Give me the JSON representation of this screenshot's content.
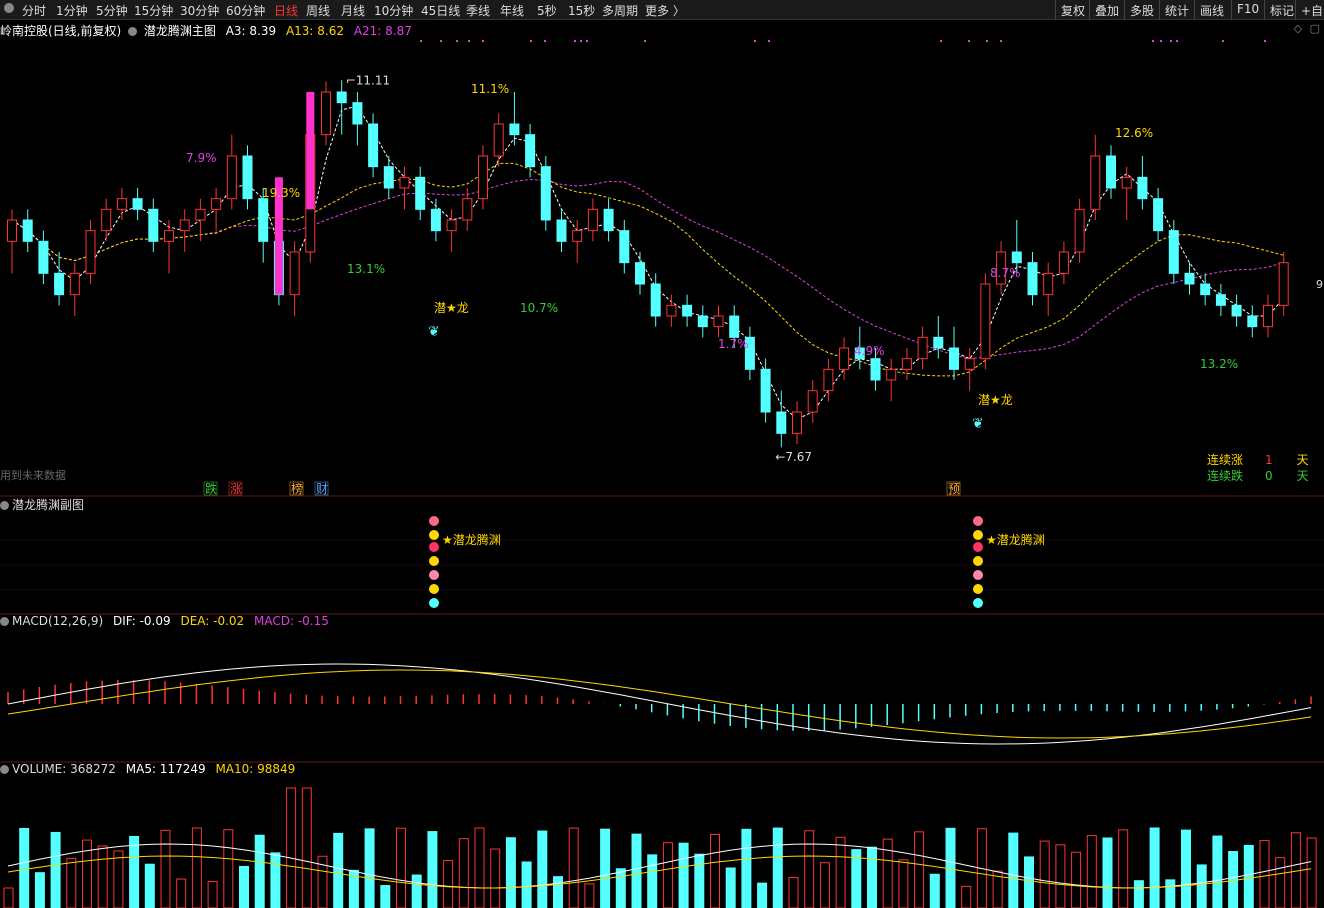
{
  "toolbar": {
    "periods": [
      "分时",
      "1分钟",
      "5分钟",
      "15分钟",
      "30分钟",
      "60分钟",
      "日线",
      "周线",
      "月线",
      "10分钟",
      "45日线",
      "季线",
      "年线",
      "5秒",
      "15秒",
      "多周期",
      "更多 〉"
    ],
    "active_period": "日线",
    "right_tools": [
      "复权",
      "叠加",
      "多股",
      "统计",
      "画线",
      "F10",
      "标记",
      "+自"
    ]
  },
  "main_chart": {
    "stock_title": "岭南控股(日线,前复权)",
    "indicator_name": "潜龙腾渊主图",
    "a3": "A3: 8.39",
    "a13": "A13: 8.62",
    "a21": "A21: 8.87",
    "high_label": "11.11",
    "low_label": "7.67",
    "future_data_note": "用到未来数据",
    "right_edge_label": "9",
    "pct_labels": [
      {
        "text": "7.9%",
        "color": "#e040e0"
      },
      {
        "text": "19.3%",
        "color": "#ffd700"
      },
      {
        "text": "11.1%",
        "color": "#ffd700"
      },
      {
        "text": "13.1%",
        "color": "#33cc33"
      },
      {
        "text": "10.7%",
        "color": "#33cc33"
      },
      {
        "text": "1.7%",
        "color": "#e040e0"
      },
      {
        "text": "4.9%",
        "color": "#e040e0"
      },
      {
        "text": "8.7%",
        "color": "#e040e0"
      },
      {
        "text": "12.6%",
        "color": "#ffd700"
      },
      {
        "text": "13.2%",
        "color": "#33cc33"
      }
    ],
    "dragon_labels": [
      "潜★龙",
      "潜★龙"
    ],
    "bottom_markers": [
      {
        "text": "跌",
        "color": "#33cc33"
      },
      {
        "text": "涨",
        "color": "#ff3333"
      },
      {
        "text": "榜",
        "color": "#ffaa33"
      },
      {
        "text": "财",
        "color": "#55aaff"
      },
      {
        "text": "预",
        "color": "#ffaa33"
      }
    ],
    "streak": {
      "up_label": "连续涨",
      "up_count": "1",
      "up_unit": "天",
      "down_label": "连续跌",
      "down_count": "0",
      "down_unit": "天"
    },
    "colors": {
      "up": "#ff3333",
      "down": "#54ffff",
      "a3": "#ffffff",
      "a13": "#ffd700",
      "a21": "#e040e0"
    }
  },
  "sub_chart": {
    "title": "潜龙腾渊副图",
    "signal_labels": [
      "★潜龙腾渊",
      "★潜龙腾渊"
    ]
  },
  "macd": {
    "title": "MACD(12,26,9)",
    "dif": "DIF: -0.09",
    "dea": "DEA: -0.02",
    "macd": "MACD: -0.15"
  },
  "volume": {
    "title": "VOLUME: 368272",
    "ma5": "MA5: 117249",
    "ma10": "MA10: 98849"
  },
  "chart_data": {
    "type": "candlestick",
    "price_high": 11.11,
    "price_low": 7.67,
    "candles": [
      [
        9.6,
        9.9,
        9.3,
        9.8
      ],
      [
        9.8,
        9.9,
        9.5,
        9.6
      ],
      [
        9.6,
        9.7,
        9.2,
        9.3
      ],
      [
        9.3,
        9.5,
        9.0,
        9.1
      ],
      [
        9.1,
        9.4,
        8.9,
        9.3
      ],
      [
        9.3,
        9.8,
        9.2,
        9.7
      ],
      [
        9.7,
        10.0,
        9.6,
        9.9
      ],
      [
        9.9,
        10.1,
        9.8,
        10.0
      ],
      [
        10.0,
        10.1,
        9.8,
        9.9
      ],
      [
        9.9,
        10.0,
        9.5,
        9.6
      ],
      [
        9.6,
        9.8,
        9.3,
        9.7
      ],
      [
        9.7,
        9.9,
        9.5,
        9.8
      ],
      [
        9.8,
        10.0,
        9.6,
        9.9
      ],
      [
        9.9,
        10.1,
        9.7,
        10.0
      ],
      [
        10.0,
        10.6,
        9.9,
        10.4
      ],
      [
        10.4,
        10.5,
        9.9,
        10.0
      ],
      [
        10.0,
        10.1,
        9.4,
        9.6
      ],
      [
        9.6,
        10.2,
        9.0,
        9.1
      ],
      [
        9.1,
        9.6,
        8.9,
        9.5
      ],
      [
        9.5,
        10.7,
        9.4,
        10.6
      ],
      [
        10.6,
        11.1,
        10.5,
        11.0
      ],
      [
        11.0,
        11.11,
        10.6,
        10.9
      ],
      [
        10.9,
        11.0,
        10.5,
        10.7
      ],
      [
        10.7,
        10.8,
        10.2,
        10.3
      ],
      [
        10.3,
        10.4,
        10.0,
        10.1
      ],
      [
        10.1,
        10.3,
        9.9,
        10.2
      ],
      [
        10.2,
        10.3,
        9.8,
        9.9
      ],
      [
        9.9,
        10.0,
        9.6,
        9.7
      ],
      [
        9.7,
        9.9,
        9.5,
        9.8
      ],
      [
        9.8,
        10.1,
        9.7,
        10.0
      ],
      [
        10.0,
        10.5,
        9.9,
        10.4
      ],
      [
        10.4,
        10.8,
        10.3,
        10.7
      ],
      [
        10.7,
        11.0,
        10.5,
        10.6
      ],
      [
        10.6,
        10.7,
        10.2,
        10.3
      ],
      [
        10.3,
        10.4,
        9.7,
        9.8
      ],
      [
        9.8,
        9.9,
        9.5,
        9.6
      ],
      [
        9.6,
        9.8,
        9.4,
        9.7
      ],
      [
        9.7,
        10.0,
        9.6,
        9.9
      ],
      [
        9.9,
        10.0,
        9.6,
        9.7
      ],
      [
        9.7,
        9.8,
        9.3,
        9.4
      ],
      [
        9.4,
        9.5,
        9.1,
        9.2
      ],
      [
        9.2,
        9.3,
        8.8,
        8.9
      ],
      [
        8.9,
        9.1,
        8.8,
        9.0
      ],
      [
        9.0,
        9.1,
        8.8,
        8.9
      ],
      [
        8.9,
        9.0,
        8.7,
        8.8
      ],
      [
        8.8,
        9.0,
        8.7,
        8.9
      ],
      [
        8.9,
        9.0,
        8.6,
        8.7
      ],
      [
        8.7,
        8.8,
        8.3,
        8.4
      ],
      [
        8.4,
        8.5,
        7.9,
        8.0
      ],
      [
        8.0,
        8.2,
        7.67,
        7.8
      ],
      [
        7.8,
        8.1,
        7.7,
        8.0
      ],
      [
        8.0,
        8.3,
        7.9,
        8.2
      ],
      [
        8.2,
        8.5,
        8.1,
        8.4
      ],
      [
        8.4,
        8.7,
        8.3,
        8.6
      ],
      [
        8.6,
        8.8,
        8.4,
        8.5
      ],
      [
        8.5,
        8.6,
        8.2,
        8.3
      ],
      [
        8.3,
        8.5,
        8.1,
        8.4
      ],
      [
        8.4,
        8.6,
        8.3,
        8.5
      ],
      [
        8.5,
        8.8,
        8.4,
        8.7
      ],
      [
        8.7,
        8.9,
        8.5,
        8.6
      ],
      [
        8.6,
        8.8,
        8.3,
        8.4
      ],
      [
        8.4,
        8.6,
        8.2,
        8.5
      ],
      [
        8.5,
        9.3,
        8.4,
        9.2
      ],
      [
        9.2,
        9.6,
        9.1,
        9.5
      ],
      [
        9.5,
        9.8,
        9.3,
        9.4
      ],
      [
        9.4,
        9.5,
        9.0,
        9.1
      ],
      [
        9.1,
        9.4,
        8.9,
        9.3
      ],
      [
        9.3,
        9.6,
        9.2,
        9.5
      ],
      [
        9.5,
        10.0,
        9.4,
        9.9
      ],
      [
        9.9,
        10.6,
        9.8,
        10.4
      ],
      [
        10.4,
        10.5,
        10.0,
        10.1
      ],
      [
        10.1,
        10.3,
        9.8,
        10.2
      ],
      [
        10.2,
        10.4,
        9.9,
        10.0
      ],
      [
        10.0,
        10.1,
        9.6,
        9.7
      ],
      [
        9.7,
        9.8,
        9.2,
        9.3
      ],
      [
        9.3,
        9.4,
        9.1,
        9.2
      ],
      [
        9.2,
        9.3,
        9.0,
        9.1
      ],
      [
        9.1,
        9.2,
        8.9,
        9.0
      ],
      [
        9.0,
        9.1,
        8.8,
        8.9
      ],
      [
        8.9,
        9.0,
        8.7,
        8.8
      ],
      [
        8.8,
        9.1,
        8.7,
        9.0
      ],
      [
        9.0,
        9.5,
        8.9,
        9.4
      ]
    ]
  }
}
